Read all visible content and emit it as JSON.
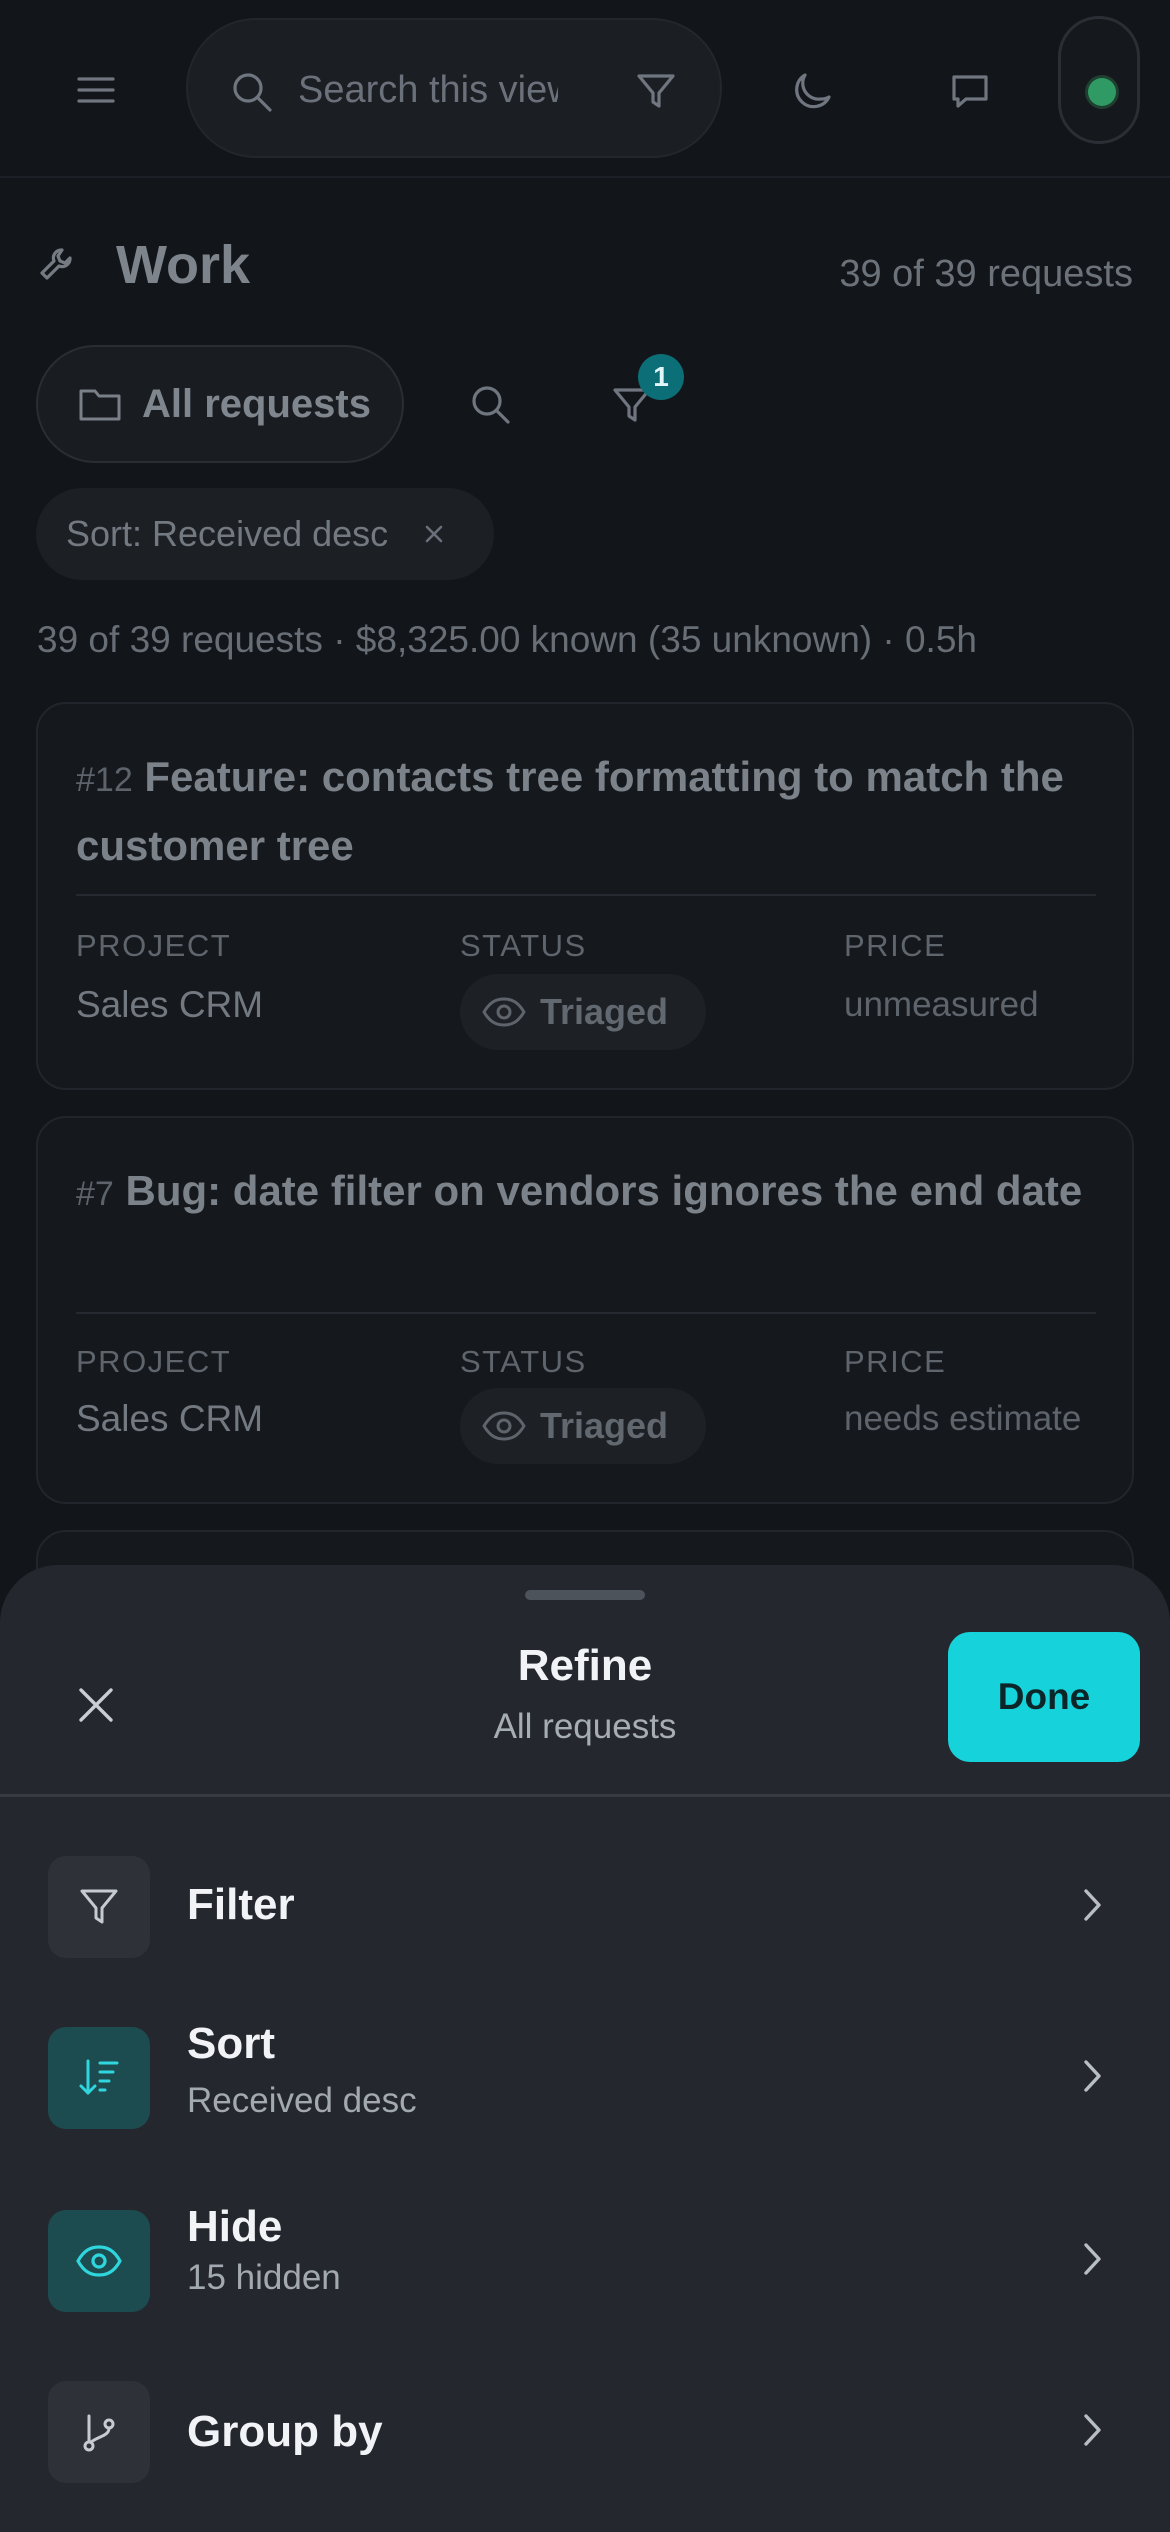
{
  "topbar": {
    "search_placeholder": "Search this view"
  },
  "page": {
    "title": "Work",
    "count": "39 of 39 requests",
    "view_label": "All requests",
    "filter_badge": "1",
    "sort_chip": "Sort: Received desc",
    "summary": "39 of 39 requests · $8,325.00 known (35 unknown) · 0.5h"
  },
  "cards": [
    {
      "number": "#12",
      "title": "Feature: contacts tree formatting to match the customer tree",
      "project_label": "PROJECT",
      "project": "Sales CRM",
      "status_label": "STATUS",
      "status": "Triaged",
      "price_label": "PRICE",
      "price": "unmeasured"
    },
    {
      "number": "#7",
      "title": "Bug: date filter on vendors ignores the end date",
      "project_label": "PROJECT",
      "project": "Sales CRM",
      "status_label": "STATUS",
      "status": "Triaged",
      "price_label": "PRICE",
      "price": "needs estimate"
    }
  ],
  "sheet": {
    "title": "Refine",
    "subtitle": "All requests",
    "done_label": "Done",
    "items": [
      {
        "label": "Filter",
        "sub": ""
      },
      {
        "label": "Sort",
        "sub": "Received desc"
      },
      {
        "label": "Hide",
        "sub": "15 hidden"
      },
      {
        "label": "Group by",
        "sub": ""
      }
    ]
  },
  "colors": {
    "accent": "#16d2da",
    "accent_dim": "#1d4c50",
    "status_online": "#2f9a64",
    "background": "#121519",
    "sheet": "#24282e"
  }
}
